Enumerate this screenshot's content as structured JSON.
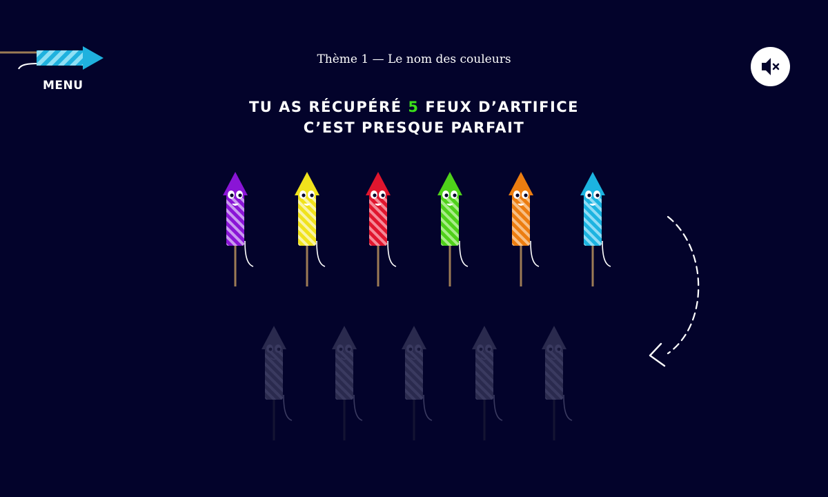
{
  "menu": {
    "label": "MENU",
    "icon": "rocket-arrow-icon",
    "stripe_colors": [
      "#1fb1de",
      "#8fe0f5"
    ]
  },
  "header": {
    "theme_title": "Thème 1 — Le nom des couleurs"
  },
  "sound": {
    "icon": "speaker-muted-icon",
    "muted": true
  },
  "result": {
    "line1_prefix": "TU AS RÉCUPÉRÉ",
    "count": "5",
    "line1_suffix": "FEUX D’ARTIFICE",
    "line2": "C’EST PRESQUE PARFAIT",
    "count_color": "#3be01a"
  },
  "collected_rockets": [
    {
      "name": "purple",
      "color": "#8a15d6",
      "light": "#c99af0"
    },
    {
      "name": "yellow",
      "color": "#f0e21c",
      "light": "#f9f4a6"
    },
    {
      "name": "red",
      "color": "#e0162e",
      "light": "#f58a98"
    },
    {
      "name": "green",
      "color": "#4fd11a",
      "light": "#a8ee88"
    },
    {
      "name": "orange",
      "color": "#ec7d10",
      "light": "#f8bf84"
    },
    {
      "name": "blue",
      "color": "#1cb3e0",
      "light": "#8fdcf5"
    }
  ],
  "empty_slots": {
    "count": 5,
    "color": "#2a2a4e",
    "light": "#3a3a60"
  },
  "return_arrow": {
    "icon": "dashed-curved-arrow-icon",
    "style": "dashed"
  }
}
